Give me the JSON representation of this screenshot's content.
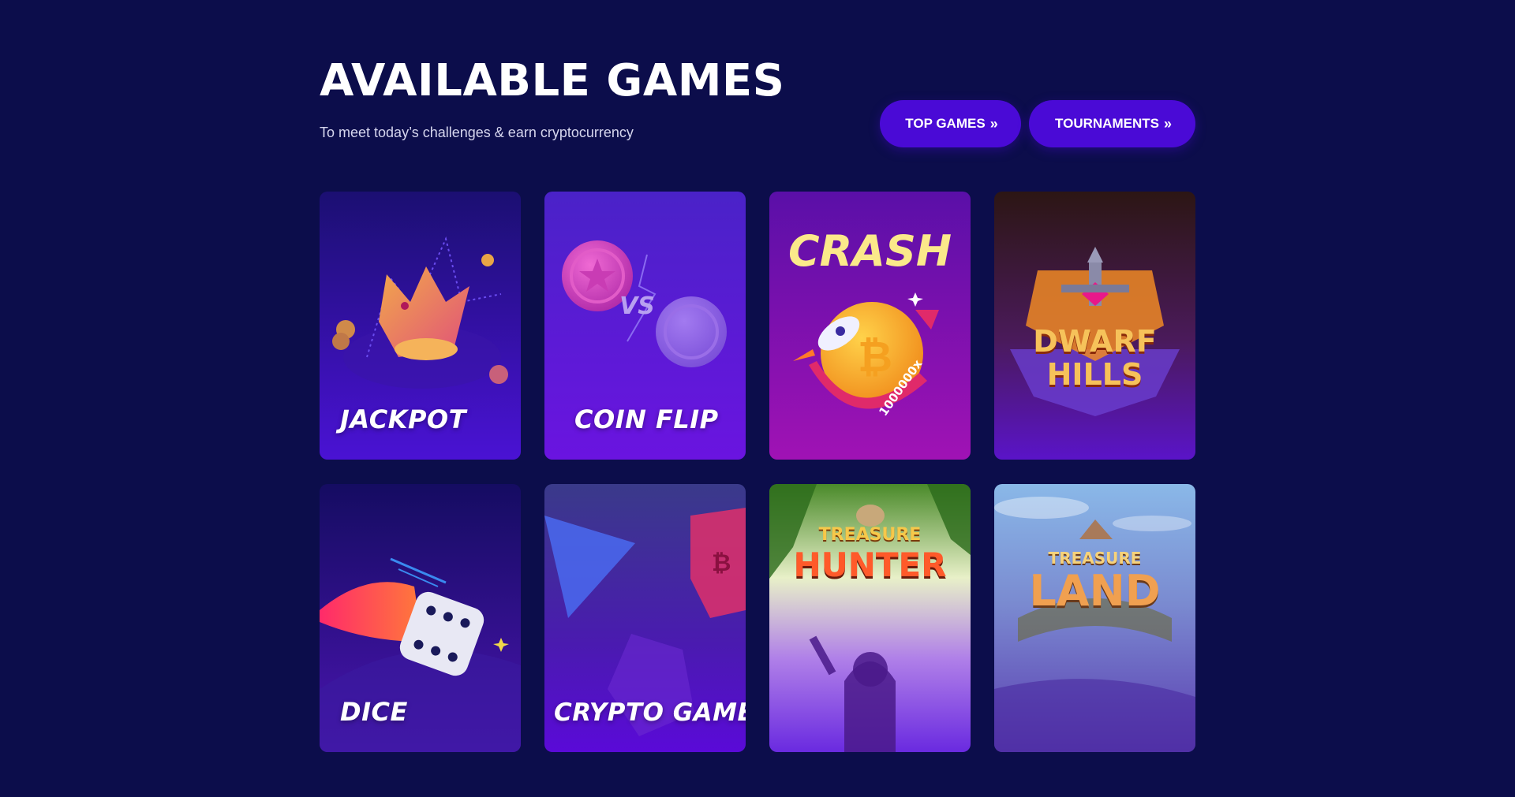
{
  "header": {
    "title": "AVAILABLE GAMES",
    "subtitle": "To meet today’s challenges & earn cryptocurrency"
  },
  "buttons": {
    "top_games": "TOP GAMES",
    "tournaments": "TOURNAMENTS",
    "chevron": "»"
  },
  "games": [
    {
      "label": "JACKPOT"
    },
    {
      "label": "COIN FLIP",
      "vs_text": "VS"
    },
    {
      "art_title": "CRASH",
      "multiplier": "1000000x"
    },
    {
      "logo_line1": "DWARF",
      "logo_line2": "HILLS"
    },
    {
      "label": "DICE"
    },
    {
      "label": "CRYPTO GAME"
    },
    {
      "logo_line1": "TREASURE",
      "logo_line2": "HUNTER"
    },
    {
      "logo_line1": "TREASURE",
      "logo_line2": "LAND"
    }
  ],
  "colors": {
    "background": "#0c0d4b",
    "button": "#4a0ad6"
  }
}
